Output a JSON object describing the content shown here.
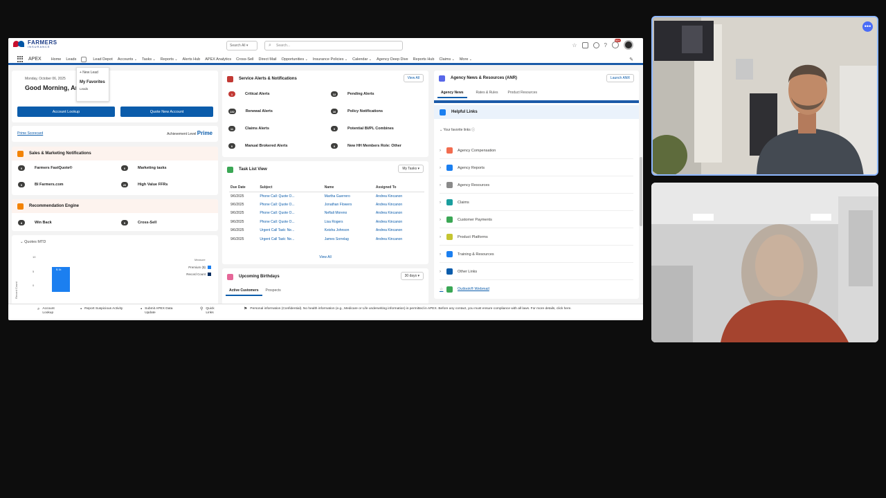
{
  "app": {
    "brand_main": "FARMERS",
    "brand_sub": "INSURANCE",
    "app_name": "APEX"
  },
  "header": {
    "search_scope": "Search All",
    "search_placeholder": "Search..."
  },
  "nav": {
    "items": [
      "Home",
      "Leads",
      "Lead Depot",
      "Accounts",
      "Tasks",
      "Reports",
      "Alerts Hub",
      "APEX Analytics",
      "Cross-Sell",
      "Direct Mail",
      "Opportunities",
      "Insurance Policies",
      "Calendar",
      "Agency Deep Dive",
      "Reports Hub",
      "Claims",
      "More"
    ]
  },
  "leads_dropdown": {
    "new_lead": "+ New Lead",
    "favorites": "My Favorites",
    "leads": "Leads"
  },
  "greeting": {
    "date": "Monday, October 06, 2025",
    "title": "Good Morning, Andrea",
    "btn_lookup": "Account Lookup",
    "btn_quote": "Quote New Account"
  },
  "prime": {
    "link": "Prime Scorecard",
    "achievement_label": "Achievement Level",
    "achievement_value": "Prime"
  },
  "sales": {
    "title": "Sales & Marketing Notifications",
    "items": [
      {
        "count": "0",
        "label": "Farmers FastQuote®"
      },
      {
        "count": "0",
        "label": "Marketing tasks"
      },
      {
        "count": "0",
        "label": "BI Farmers.com"
      },
      {
        "count": "20",
        "label": "High Value FFRs"
      }
    ]
  },
  "reco": {
    "title": "Recommendation Engine",
    "items": [
      {
        "count": "8",
        "label": "Win Back"
      },
      {
        "count": "9",
        "label": "Cross-Sell"
      }
    ]
  },
  "quotes": {
    "title": "Quotes MTD",
    "y_label": "Record Count",
    "legend_title": "Measure",
    "legend": [
      "Premium ($)",
      "Record Count"
    ],
    "bar_label": "$ 1k"
  },
  "alerts": {
    "title": "Service Alerts & Notifications",
    "view_all": "View All",
    "items": [
      {
        "count": "1",
        "label": "Critical Alerts"
      },
      {
        "count": "12",
        "label": "Pending Alerts"
      },
      {
        "count": "132",
        "label": "Renewal Alerts"
      },
      {
        "count": "16",
        "label": "Policy Notifications"
      },
      {
        "count": "11",
        "label": "Claims Alerts"
      },
      {
        "count": "0",
        "label": "Potential BI/PL Combines"
      },
      {
        "count": "0",
        "label": "Manual Brokered Alerts"
      },
      {
        "count": "0",
        "label": "New HH Members Role: Other"
      }
    ]
  },
  "tasks": {
    "title": "Task List View",
    "filter": "My Tasks",
    "columns": [
      "Due Date",
      "Subject",
      "Name",
      "Assigned To"
    ],
    "rows": [
      [
        "9/6/2025",
        "Phone Call: Quote O...",
        "Martha Guerrero",
        "Andrea Kincanon"
      ],
      [
        "9/6/2025",
        "Phone Call: Quote O...",
        "Jonathan Flowers",
        "Andrea Kincanon"
      ],
      [
        "9/6/2025",
        "Phone Call: Quote O...",
        "Neftali Moreno",
        "Andrea Kincanon"
      ],
      [
        "9/6/2025",
        "Phone Call: Quote O...",
        "Lisa Rogers",
        "Andrea Kincanon"
      ],
      [
        "9/6/2025",
        "Urgent Call Task: Ne...",
        "Keisha Johnson",
        "Andrea Kincanon"
      ],
      [
        "9/6/2025",
        "Urgent Call Task: Ne...",
        "James Sorrelag",
        "Andrea Kincanon"
      ]
    ],
    "view_all": "View All"
  },
  "birthdays": {
    "title": "Upcoming Birthdays",
    "filter": "30 days",
    "tabs": [
      "Active Customers",
      "Prospects"
    ]
  },
  "anr": {
    "title": "Agency News & Resources (ANR)",
    "launch": "Launch ANR",
    "tabs": [
      "Agency News",
      "Rates & Rules",
      "Product Resources"
    ],
    "helpful_title": "Helpful Links",
    "favorites_label": "Your favorite links",
    "links": [
      "Agency Compensation",
      "Agency Reports",
      "Agency Resources",
      "Claims",
      "Customer Payments",
      "Product Platforms",
      "Training & Resources",
      "Other Links",
      "Outlook® Webmail"
    ]
  },
  "bottom": {
    "items": [
      "Account Lookup",
      "Report Suspicious Activity",
      "Submit APEX Data Update",
      "Quick Links"
    ],
    "notice": "Personal information (Confidential). No health information (e.g., Medicare or Life underwriting information) is permitted in APEX. Before any contact, you must ensure compliance with all laws. For more details, click here."
  },
  "colors": {
    "brand_blue": "#0b5cab",
    "nav_underline": "#1b5aa8",
    "alert_red": "#c23934",
    "tile_border": "#8fb8ff",
    "more_button": "#4a6cf7"
  }
}
